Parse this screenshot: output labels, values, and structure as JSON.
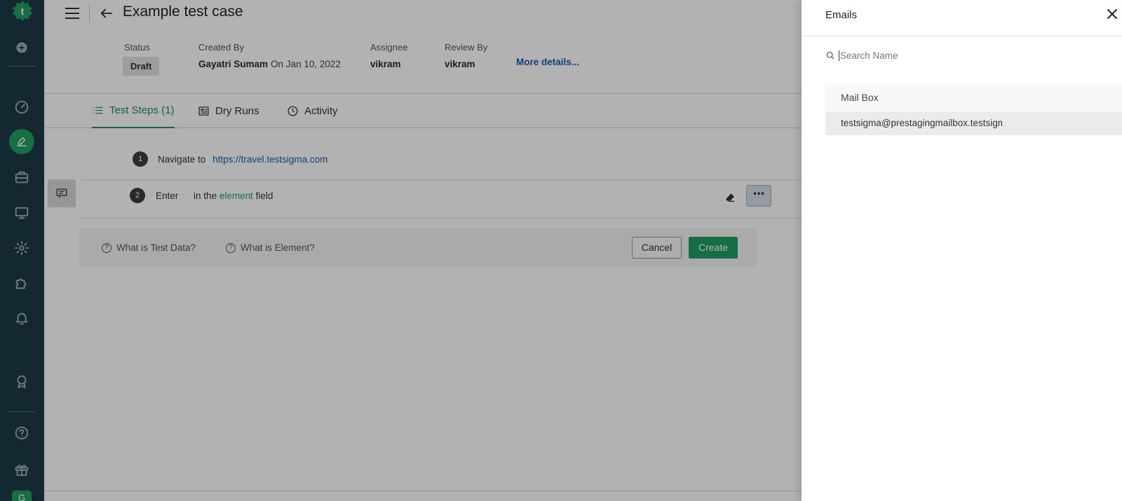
{
  "header": {
    "title": "Example test case",
    "status_label": "Status",
    "status_value": "Draft",
    "created_by_label": "Created By",
    "created_by_value": "Gayatri Sumam",
    "created_on": "On Jan 10, 2022",
    "assignee_label": "Assignee",
    "assignee_value": "vikram",
    "review_by_label": "Review By",
    "review_by_value": "vikram",
    "more_details": "More details..."
  },
  "tabs": [
    {
      "label": "Test Steps (1)",
      "icon": "list-icon",
      "active": true
    },
    {
      "label": "Dry Runs",
      "icon": "report-icon",
      "active": false
    },
    {
      "label": "Activity",
      "icon": "clock-icon",
      "active": false
    }
  ],
  "steps": [
    {
      "num": "1",
      "action": "Navigate to",
      "url": "https://travel.testsigma.com"
    },
    {
      "num": "2",
      "action": "Enter",
      "middle": "in the",
      "element": "element",
      "suffix": "field"
    }
  ],
  "help": {
    "test_data": "What is Test Data?",
    "element": "What is Element?",
    "cancel": "Cancel",
    "create": "Create"
  },
  "panel": {
    "title": "Emails",
    "search_placeholder": "Search Name",
    "mailbox_header": "Mail Box",
    "mailbox_item": "testsigma@prestagingmailbox.testsigma"
  },
  "nav": {
    "icons": [
      "logo-icon",
      "add-icon",
      "dashboard-icon",
      "pen-icon",
      "briefcase-icon",
      "monitor-icon",
      "settings-icon",
      "puzzle-icon",
      "bell-icon",
      "award-icon",
      "help-icon",
      "gift-icon"
    ],
    "avatar": "G"
  },
  "colors": {
    "accent": "#1f9e62",
    "nav_bg": "#1d3a47",
    "link": "#1b5ea8"
  }
}
